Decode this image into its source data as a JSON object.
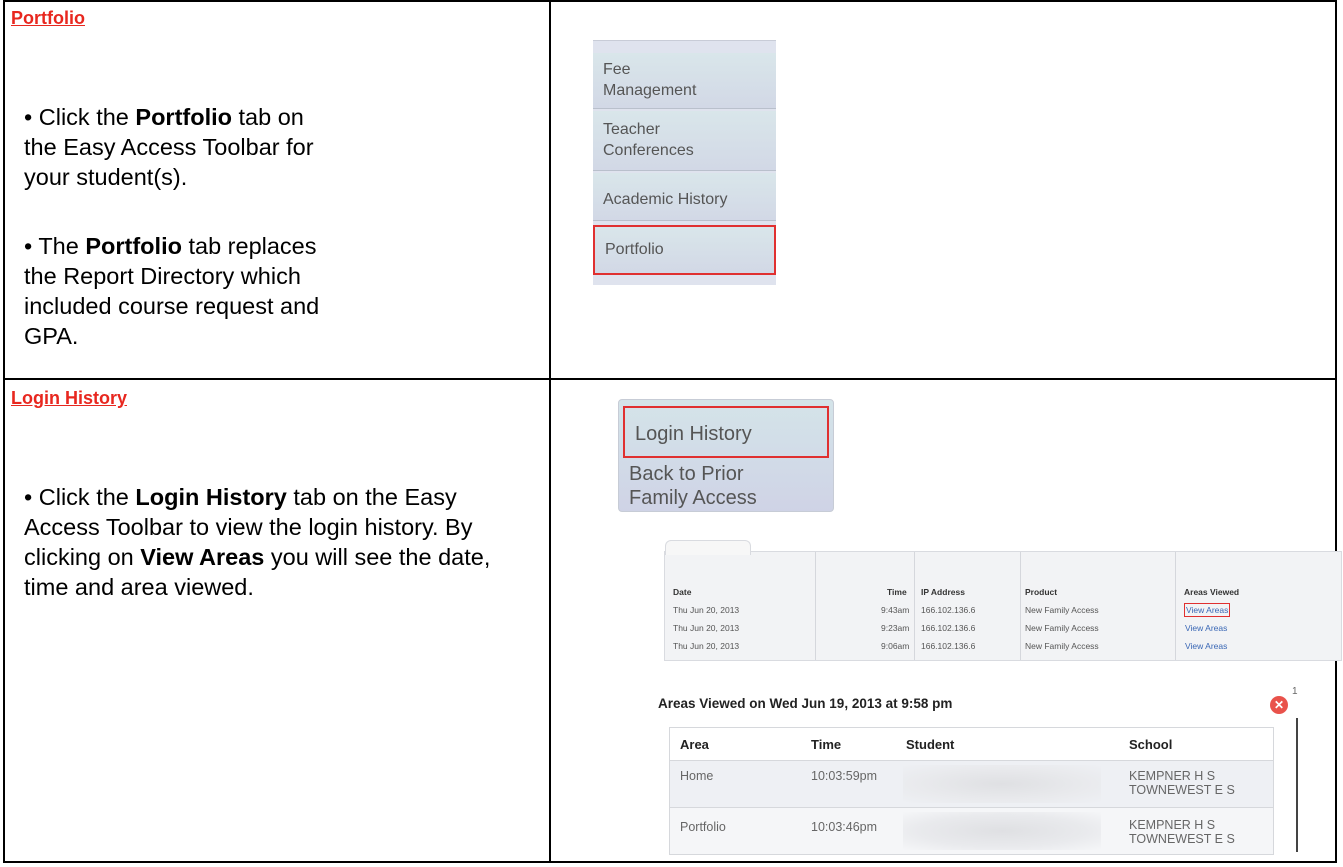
{
  "portfolio": {
    "title": "Portfolio",
    "bullet1_prefix": "• Click the ",
    "bullet1_bold": "Portfolio",
    "bullet1_suffix": " tab on the Easy Access Toolbar for your student(s).",
    "bullet2_prefix": "• The ",
    "bullet2_bold": "Portfolio",
    "bullet2_suffix": " tab replaces the Report Directory which included course request and GPA.",
    "nav_items": [
      "Fee",
      "Management",
      "Teacher",
      "Conferences",
      "Academic History",
      "Portfolio"
    ]
  },
  "login": {
    "title": "Login History",
    "bullet_prefix": "• Click the ",
    "bullet_bold1": "Login History",
    "bullet_mid": " tab on the Easy Access Toolbar to view the login history.  By clicking on ",
    "bullet_bold2": "View Areas",
    "bullet_suffix": " you will see the date, time and area viewed.",
    "nav_items": [
      "Login History",
      "Back to Prior",
      "Family Access"
    ],
    "table": {
      "headers": [
        "Date",
        "Time",
        "IP Address",
        "Product",
        "Areas Viewed"
      ],
      "rows": [
        [
          "Thu Jun 20, 2013",
          "9:43am",
          "166.102.136.6",
          "New Family Access",
          "View Areas"
        ],
        [
          "Thu Jun 20, 2013",
          "9:23am",
          "166.102.136.6",
          "New Family Access",
          "View Areas"
        ],
        [
          "Thu Jun 20, 2013",
          "9:06am",
          "166.102.136.6",
          "New Family Access",
          "View Areas"
        ]
      ]
    },
    "areas": {
      "title": "Areas Viewed on Wed Jun 19, 2013 at 9:58 pm",
      "close_sup": "1",
      "headers": [
        "Area",
        "Time",
        "Student",
        "School"
      ],
      "rows": [
        {
          "area": "Home",
          "time": "10:03:59pm",
          "school1": "KEMPNER H S",
          "school2": "TOWNEWEST E S"
        },
        {
          "area": "Portfolio",
          "time": "10:03:46pm",
          "school1": "KEMPNER H S",
          "school2": "TOWNEWEST E S"
        }
      ]
    }
  }
}
